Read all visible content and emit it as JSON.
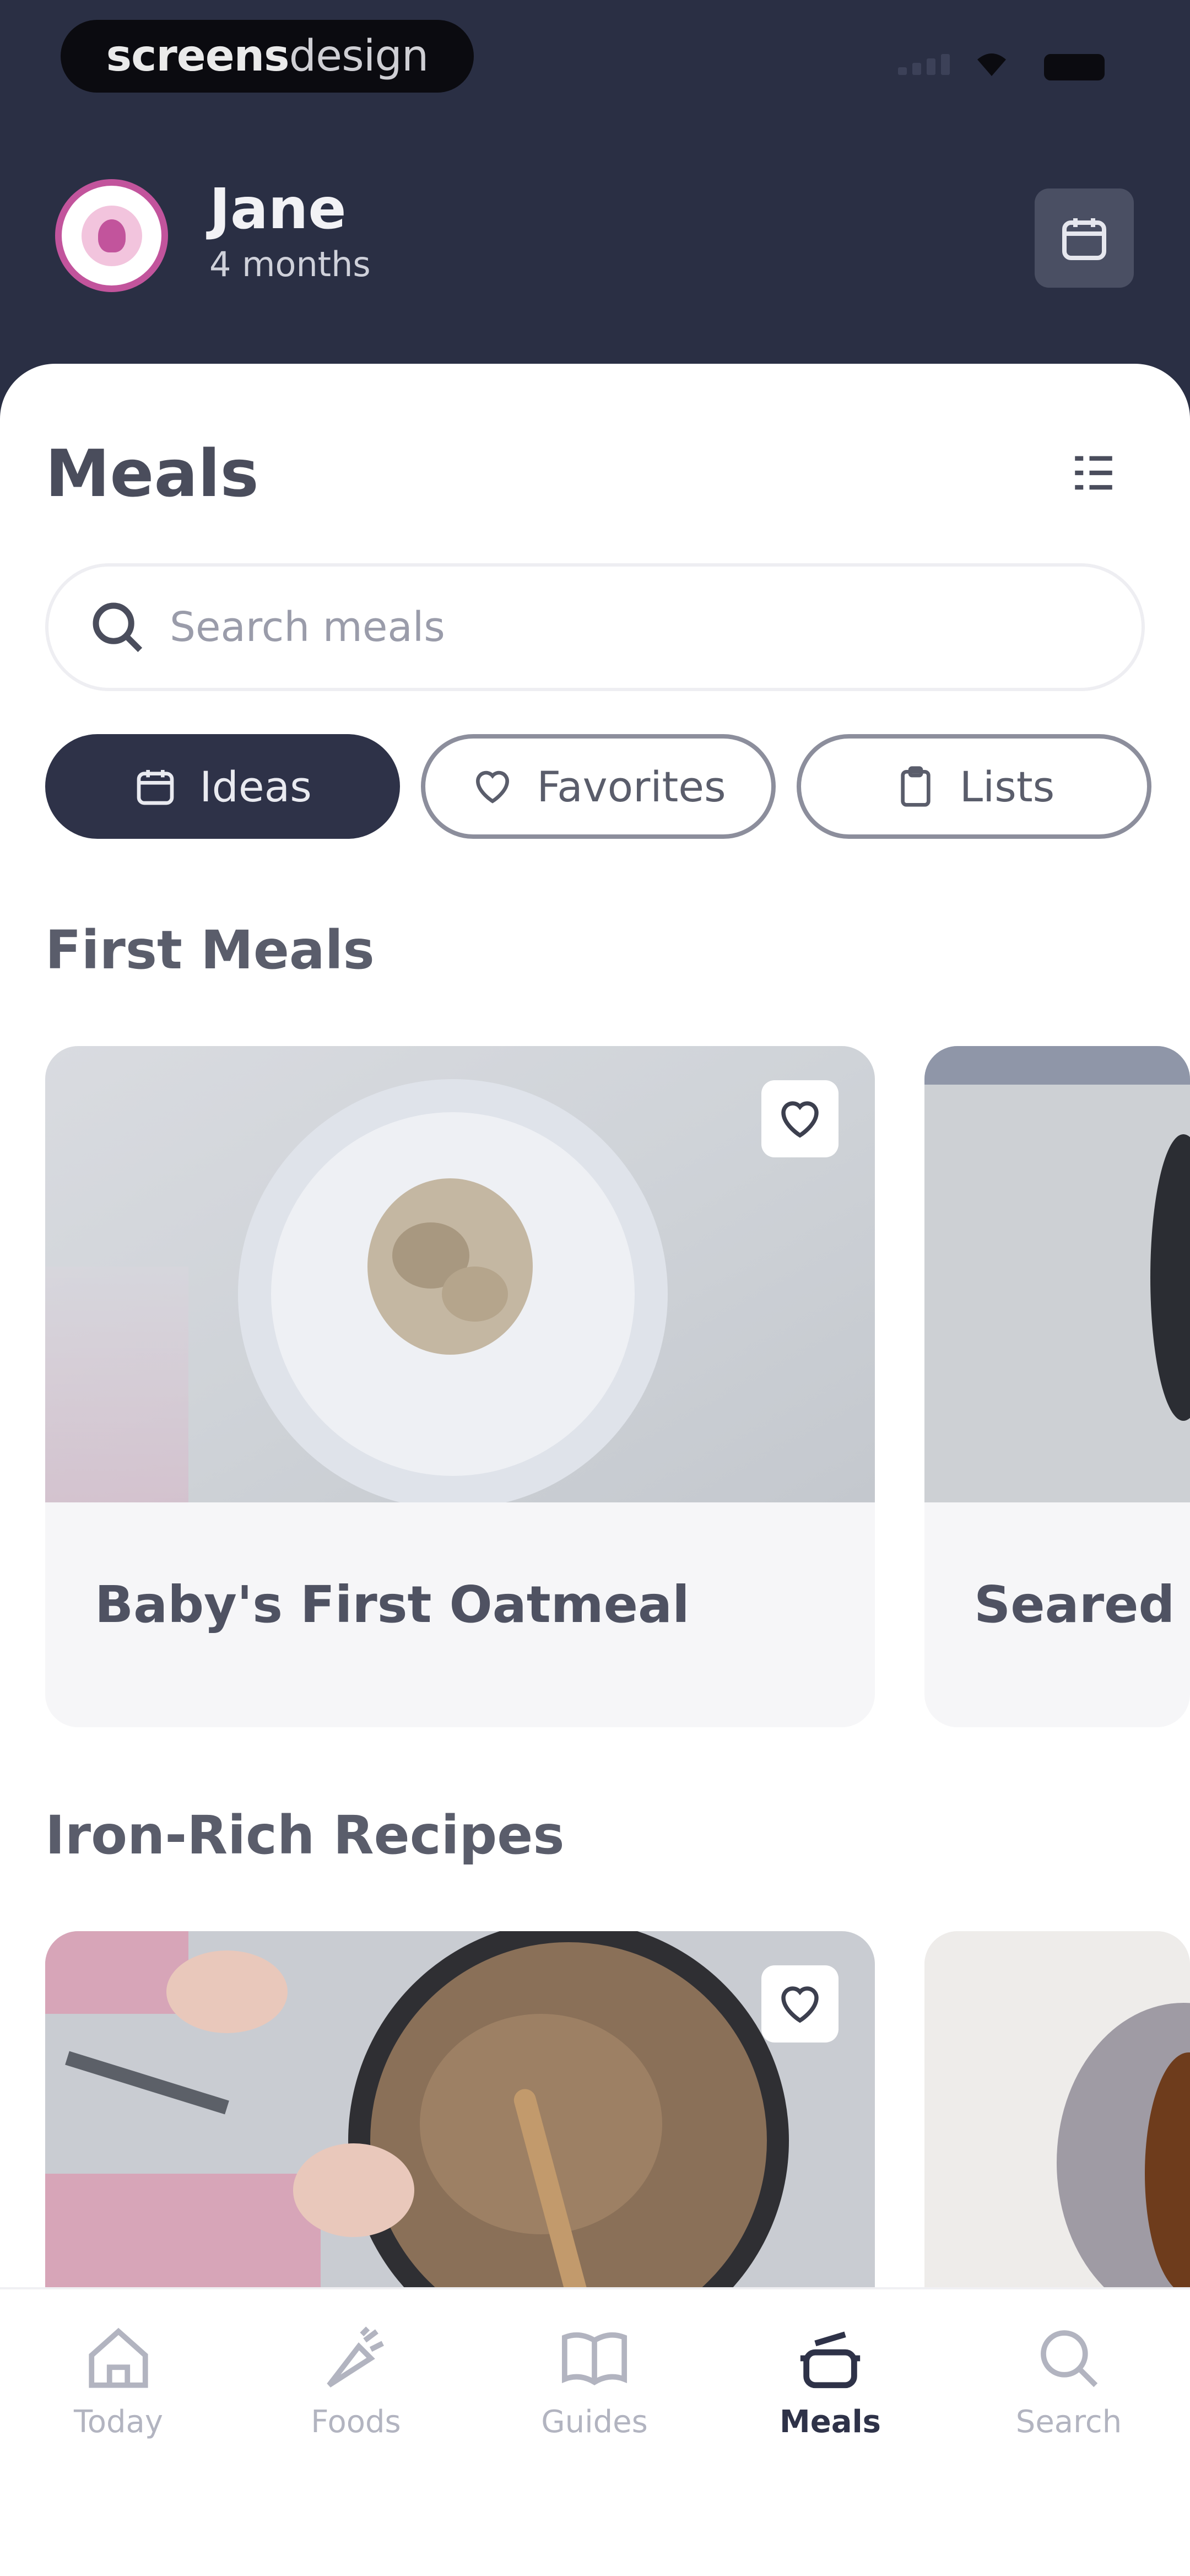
{
  "status_bar": {
    "brand_bold": "screens",
    "brand_light": "design"
  },
  "header": {
    "name": "Jane",
    "age": "4 months",
    "icons": [
      "avatar-icon",
      "calendar-icon"
    ]
  },
  "meals": {
    "title": "Meals",
    "search_placeholder": "Search meals",
    "chips": [
      {
        "label": "Ideas",
        "icon": "calendar-icon",
        "active": true
      },
      {
        "label": "Favorites",
        "icon": "heart-icon",
        "active": false
      },
      {
        "label": "Lists",
        "icon": "clipboard-icon",
        "active": false
      }
    ],
    "sections": [
      {
        "title": "First Meals",
        "cards": [
          {
            "label": "Baby's First Oatmeal"
          },
          {
            "label": "Seared"
          }
        ]
      },
      {
        "title": "Iron-Rich Recipes",
        "cards": [
          {
            "label": ""
          },
          {
            "label": ""
          }
        ]
      }
    ]
  },
  "nav": {
    "items": [
      {
        "label": "Today",
        "icon": "home-icon",
        "active": false
      },
      {
        "label": "Foods",
        "icon": "carrot-icon",
        "active": false
      },
      {
        "label": "Guides",
        "icon": "book-icon",
        "active": false
      },
      {
        "label": "Meals",
        "icon": "pot-icon",
        "active": true
      },
      {
        "label": "Search",
        "icon": "search-icon",
        "active": false
      }
    ]
  },
  "colors": {
    "header_bg": "#2a2f44",
    "accent_dark": "#2e3248",
    "avatar_ring": "#c2549c"
  }
}
